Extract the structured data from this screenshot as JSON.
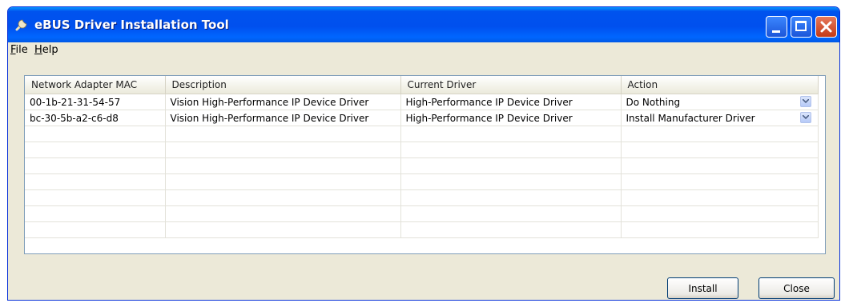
{
  "window": {
    "title": "eBUS Driver Installation Tool",
    "icon": "wrench-icon"
  },
  "menu": [
    {
      "label": "File",
      "mnemonic": "F"
    },
    {
      "label": "Help",
      "mnemonic": "H"
    }
  ],
  "table": {
    "columns": [
      "Network Adapter MAC",
      "Description",
      "Current Driver",
      "Action"
    ],
    "rows": [
      {
        "mac": "00-1b-21-31-54-57",
        "description": "Vision High-Performance IP Device Driver",
        "current_driver": "High-Performance IP Device Driver",
        "action": "Do Nothing"
      },
      {
        "mac": "bc-30-5b-a2-c6-d8",
        "description": "Vision High-Performance IP Device Driver",
        "current_driver": "High-Performance IP Device Driver",
        "action": "Install Manufacturer Driver"
      }
    ],
    "empty_rows": 7
  },
  "buttons": {
    "install": "Install",
    "close": "Close"
  },
  "colors": {
    "titlebar": "#0050ee",
    "close_button": "#c33a17",
    "window_bg": "#ece9d8"
  }
}
